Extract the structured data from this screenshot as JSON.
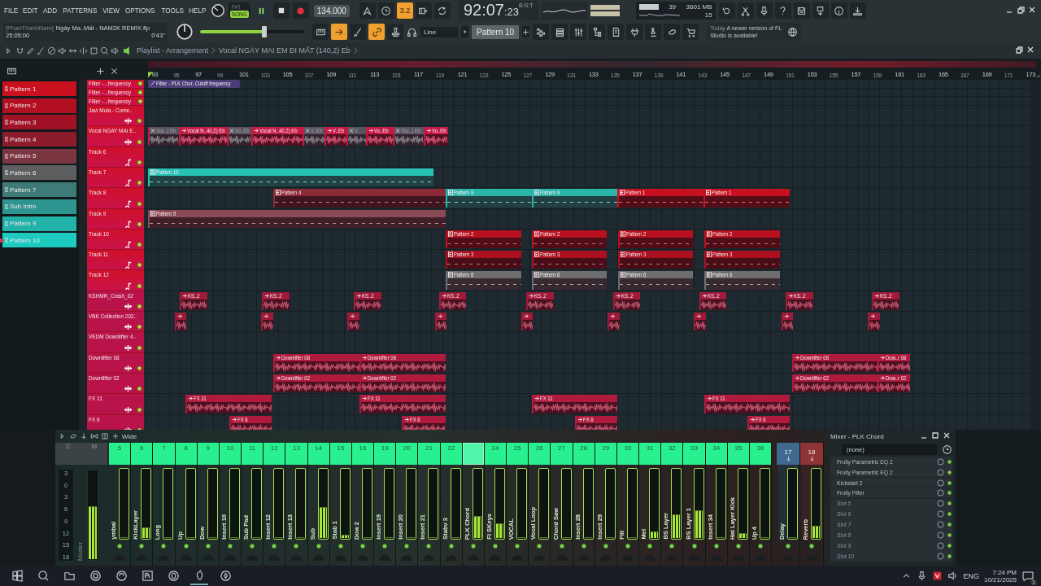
{
  "menu": [
    "FILE",
    "EDIT",
    "ADD",
    "PATTERNS",
    "VIEW",
    "OPTIONS",
    "TOOLS",
    "HELP"
  ],
  "transport": {
    "modes": [
      {
        "label": "PAT",
        "selected": false
      },
      {
        "label": "SONG",
        "selected": true
      }
    ],
    "tempo": "134.000"
  },
  "snap_buttons": [
    {
      "on": false
    },
    {
      "on": false
    },
    {
      "label": "3.2",
      "on": true
    },
    {
      "on": false
    },
    {
      "on": false
    }
  ],
  "time": {
    "main": "92:07",
    "ticks": ":23",
    "unit": "B:S:T"
  },
  "monitor": {
    "polyphony": "39",
    "memory": "3601 MB",
    "cpu": "15"
  },
  "project": {
    "user": "[PhanThanhNam]",
    "file": "Ngày Ma..Mất - NAM2K REMIX.flp",
    "length": "25:05:00",
    "time": "0'43''"
  },
  "master_volume": {
    "level": 0.62
  },
  "tool_buttons": [
    {
      "on": false
    },
    {
      "on": true
    },
    {
      "on": false
    },
    {
      "on": true
    },
    {
      "on": false
    }
  ],
  "draw_mode": "Line",
  "pattern_selector": "Pattern 10",
  "news": {
    "date": "Today",
    "text": "A newer version of FL Studio is available!"
  },
  "playlist": {
    "title": "Playlist - Arrangement",
    "clip": "Vocal NGÀY MAI EM ĐI MẤT (140,2) Eb",
    "ruler": [
      "93",
      "95",
      "97",
      "99",
      "101",
      "103",
      "105",
      "107",
      "109",
      "111",
      "113",
      "115",
      "117",
      "119",
      "121",
      "123",
      "125",
      "127",
      "129",
      "131",
      "133",
      "135",
      "137",
      "139",
      "141",
      "143",
      "145",
      "147",
      "149",
      "151",
      "153",
      "155",
      "157",
      "159",
      "161",
      "163",
      "165",
      "167",
      "169",
      "171",
      "173"
    ],
    "patterns": [
      {
        "label": "Pattern 1",
        "color": "#c8101e",
        "selected": false
      },
      {
        "label": "Pattern 2",
        "color": "#b20f20",
        "selected": false
      },
      {
        "label": "Pattern 3",
        "color": "#a21226",
        "selected": false
      },
      {
        "label": "Pattern 4",
        "color": "#8c1b2c",
        "selected": false
      },
      {
        "label": "Pattern 5",
        "color": "#7a3640",
        "selected": false
      },
      {
        "label": "Pattern 6",
        "color": "#5c5e60",
        "selected": false
      },
      {
        "label": "Pattern 7",
        "color": "#3e7a78",
        "selected": false
      },
      {
        "label": "Sub Intro",
        "color": "#2d9590",
        "selected": false
      },
      {
        "label": "Pattern 9",
        "color": "#22b2aa",
        "selected": false
      },
      {
        "label": "Pattern 10",
        "color": "#1ccabf",
        "selected": true
      }
    ],
    "tracks": [
      {
        "name": "Filter - ..frequency",
        "kind": "automation",
        "clips": [
          {
            "kind": "automation",
            "label": "Filter - PLK Chor..Cutoff frequency",
            "color": "#4c3d78",
            "muted": false
          }
        ]
      },
      {
        "name": "Filter - ..frequency",
        "kind": "automation"
      },
      {
        "name": "Filter - ..frequency",
        "kind": "automation"
      },
      {
        "name": "Javi Mula - Come..",
        "kind": "audio"
      },
      {
        "name": "Vocal NGAY MAI E..",
        "kind": "audio",
        "clips": [
          {
            "kind": "audio",
            "label": "Voc..) Eb",
            "color": "#c41a44",
            "muted": true
          },
          {
            "kind": "audio",
            "label": "Vocal N..40,2) Eb",
            "color": "#c41a44",
            "muted": false
          },
          {
            "kind": "audio",
            "label": "Vo..Eb",
            "color": "#c41a44",
            "muted": true
          },
          {
            "kind": "audio",
            "label": "Vocal N..40,2) Eb",
            "color": "#c41a44",
            "muted": false
          },
          {
            "kind": "audio",
            "label": "V..Eb",
            "color": "#c41a44",
            "muted": true
          },
          {
            "kind": "audio",
            "label": "V..Eb",
            "color": "#c41a44",
            "muted": false
          },
          {
            "kind": "audio",
            "label": "V..",
            "color": "#c41a44",
            "muted": true
          },
          {
            "kind": "audio",
            "label": "Vo..Eb",
            "color": "#c41a44",
            "muted": false
          },
          {
            "kind": "audio",
            "label": "Voc..) Eb",
            "color": "#c41a44",
            "muted": true
          },
          {
            "kind": "audio",
            "label": "Vo..Eb",
            "color": "#c41a44",
            "muted": false
          }
        ]
      },
      {
        "name": "Track 6",
        "kind": "pattern"
      },
      {
        "name": "Track 7",
        "kind": "pattern",
        "clips": [
          {
            "kind": "pattern",
            "label": "Pattern 10",
            "color": "#27c2b4",
            "muted": false
          }
        ]
      },
      {
        "name": "Track 8",
        "kind": "pattern",
        "clips": [
          {
            "kind": "pattern",
            "label": "Pattern 4",
            "color": "#8c2a38",
            "muted": false
          },
          {
            "kind": "pattern",
            "label": "Pattern 9",
            "color": "#2ab5aa",
            "muted": false
          },
          {
            "kind": "pattern",
            "label": "Pattern 9",
            "color": "#2ab5aa",
            "muted": false
          },
          {
            "kind": "pattern",
            "label": "Pattern 1",
            "color": "#c81020",
            "muted": false
          },
          {
            "kind": "pattern",
            "label": "Pattern 1",
            "color": "#c81020",
            "muted": false
          }
        ]
      },
      {
        "name": "Track 9",
        "kind": "pattern",
        "clips": [
          {
            "kind": "pattern",
            "label": "Pattern 5",
            "color": "#8a4a55",
            "muted": false
          }
        ]
      },
      {
        "name": "Track 10",
        "kind": "pattern",
        "clips": [
          {
            "kind": "pattern",
            "label": "Pattern 2",
            "color": "#b8101e",
            "muted": false
          },
          {
            "kind": "pattern",
            "label": "Pattern 2",
            "color": "#b8101e",
            "muted": false
          },
          {
            "kind": "pattern",
            "label": "Pattern 2",
            "color": "#b8101e",
            "muted": false
          },
          {
            "kind": "pattern",
            "label": "Pattern 2",
            "color": "#b8101e",
            "muted": false
          }
        ]
      },
      {
        "name": "Track 11",
        "kind": "pattern",
        "clips": [
          {
            "kind": "pattern",
            "label": "Pattern 3",
            "color": "#aa1020",
            "muted": false
          },
          {
            "kind": "pattern",
            "label": "Pattern 3",
            "color": "#aa1020",
            "muted": false
          },
          {
            "kind": "pattern",
            "label": "Pattern 3",
            "color": "#aa1020",
            "muted": false
          },
          {
            "kind": "pattern",
            "label": "Pattern 3",
            "color": "#aa1020",
            "muted": false
          }
        ]
      },
      {
        "name": "Track 12",
        "kind": "pattern",
        "clips": [
          {
            "kind": "pattern",
            "label": "Pattern 6",
            "color": "#6e6e70",
            "muted": false
          },
          {
            "kind": "pattern",
            "label": "Pattern 6",
            "color": "#6e6e70",
            "muted": false
          },
          {
            "kind": "pattern",
            "label": "Pattern 6",
            "color": "#6e6e70",
            "muted": false
          },
          {
            "kind": "pattern",
            "label": "Pattern 6",
            "color": "#6e6e70",
            "muted": false
          }
        ]
      },
      {
        "name": "KSHMR_Crash_02",
        "kind": "audio",
        "clips": [
          {
            "kind": "audio",
            "label": "KS..2",
            "color": "#a01a3a",
            "muted": false
          },
          {
            "kind": "audio",
            "label": "KS..2",
            "color": "#a01a3a",
            "muted": false
          },
          {
            "kind": "audio",
            "label": "KS..2",
            "color": "#a01a3a",
            "muted": false
          },
          {
            "kind": "audio",
            "label": "KS..2",
            "color": "#a01a3a",
            "muted": false
          },
          {
            "kind": "audio",
            "label": "KS..2",
            "color": "#a01a3a",
            "muted": false
          },
          {
            "kind": "audio",
            "label": "KS..2",
            "color": "#a01a3a",
            "muted": false
          },
          {
            "kind": "audio",
            "label": "KS..2",
            "color": "#a01a3a",
            "muted": false
          },
          {
            "kind": "audio",
            "label": "KS..2",
            "color": "#a01a3a",
            "muted": false
          },
          {
            "kind": "audio",
            "label": "KS..2",
            "color": "#a01a3a",
            "muted": false
          }
        ]
      },
      {
        "name": "VBK Collection 202..",
        "kind": "audio",
        "clips": [
          {
            "kind": "audio",
            "color": "#a01a3a",
            "muted": false
          },
          {
            "kind": "audio",
            "color": "#a01a3a",
            "muted": false
          },
          {
            "kind": "audio",
            "color": "#a01a3a",
            "muted": false
          },
          {
            "kind": "audio",
            "color": "#a01a3a",
            "muted": false
          },
          {
            "kind": "audio",
            "color": "#a01a3a",
            "muted": false
          },
          {
            "kind": "audio",
            "color": "#a01a3a",
            "muted": false
          },
          {
            "kind": "audio",
            "color": "#a01a3a",
            "muted": false
          },
          {
            "kind": "audio",
            "color": "#a01a3a",
            "muted": false
          },
          {
            "kind": "audio",
            "color": "#a01a3a",
            "muted": false
          }
        ]
      },
      {
        "name": "VEDM Downlifter 4..",
        "kind": "audio"
      },
      {
        "name": "Downlifter 08",
        "kind": "audio",
        "clips": [
          {
            "kind": "audio",
            "label": "Downlifter 08",
            "color": "#b01a3c",
            "muted": false
          },
          {
            "kind": "audio",
            "label": "Downlifter 08",
            "color": "#b01a3c",
            "muted": false
          },
          {
            "kind": "audio",
            "label": "Downlifter 08",
            "color": "#b01a3c",
            "muted": false
          },
          {
            "kind": "audio",
            "label": "Dow..r 08",
            "color": "#b01a3c",
            "muted": false
          }
        ]
      },
      {
        "name": "Downlifter 02",
        "kind": "audio",
        "clips": [
          {
            "kind": "audio",
            "label": "Downlifter 02",
            "color": "#b01a3c",
            "muted": false
          },
          {
            "kind": "audio",
            "label": "Downlifter 02",
            "color": "#b01a3c",
            "muted": false
          },
          {
            "kind": "audio",
            "label": "Downlifter 02",
            "color": "#b01a3c",
            "muted": false
          },
          {
            "kind": "audio",
            "label": "Dow..r 02",
            "color": "#b01a3c",
            "muted": false
          }
        ]
      },
      {
        "name": "FX 11",
        "kind": "audio",
        "clips": [
          {
            "kind": "audio",
            "label": "FX 11",
            "color": "#b01a3c",
            "muted": false
          },
          {
            "kind": "audio",
            "label": "FX 11",
            "color": "#b01a3c",
            "muted": false
          },
          {
            "kind": "audio",
            "label": "FX 11",
            "color": "#b01a3c",
            "muted": false
          },
          {
            "kind": "audio",
            "label": "FX 11",
            "color": "#b01a3c",
            "muted": false
          }
        ]
      },
      {
        "name": "FX 6",
        "kind": "audio",
        "clips": [
          {
            "kind": "audio",
            "label": "FX 6",
            "color": "#b01a3c",
            "muted": false
          },
          {
            "kind": "audio",
            "label": "FX 6",
            "color": "#b01a3c",
            "muted": false
          },
          {
            "kind": "audio",
            "label": "FX 6",
            "color": "#b01a3c",
            "muted": false
          },
          {
            "kind": "audio",
            "label": "FX 6",
            "color": "#b01a3c",
            "muted": false
          }
        ]
      }
    ]
  },
  "mixer": {
    "toolbar_label": "Wide",
    "master": {
      "labels": [
        "C",
        "M"
      ],
      "scale": [
        "3",
        "0",
        "3",
        "6",
        "9",
        "12",
        "15",
        "18"
      ],
      "name": "Master",
      "level": 0.6
    },
    "strips": [
      {
        "number": "5",
        "name": "ymbal",
        "level": 0,
        "selected": false
      },
      {
        "number": "6",
        "name": "KickLayer",
        "level": 0.15,
        "selected": false
      },
      {
        "number": "7",
        "name": "Long",
        "level": 0,
        "selected": false
      },
      {
        "number": "8",
        "name": "Up",
        "level": 0,
        "selected": false
      },
      {
        "number": "9",
        "name": "Dow",
        "level": 0,
        "selected": false
      },
      {
        "number": "10",
        "name": "Insert 10",
        "level": 0,
        "selected": false
      },
      {
        "number": "11",
        "name": "Sub Pad",
        "level": 0,
        "selected": false
      },
      {
        "number": "12",
        "name": "Insert 12",
        "level": 0,
        "selected": false
      },
      {
        "number": "13",
        "name": "Insert 13",
        "level": 0,
        "selected": false
      },
      {
        "number": "14",
        "name": "Sub",
        "level": 0.45,
        "selected": false
      },
      {
        "number": "15",
        "name": "Stab 1",
        "level": 0.05,
        "selected": false
      },
      {
        "number": "16",
        "name": "Dow 2",
        "level": 0,
        "selected": false
      },
      {
        "number": "19",
        "name": "Insert 19",
        "level": 0,
        "selected": false
      },
      {
        "number": "20",
        "name": "Insert 20",
        "level": 0,
        "selected": false
      },
      {
        "number": "21",
        "name": "Insert 21",
        "level": 0,
        "selected": false
      },
      {
        "number": "22",
        "name": "Stabv 3",
        "level": 0,
        "selected": false
      },
      {
        "name": "PLK Chord",
        "level": 0.32,
        "selected": true
      },
      {
        "number": "24",
        "name": "Fl SKeys",
        "level": 0.22,
        "selected": false
      },
      {
        "number": "25",
        "name": "VOCAL",
        "level": 0,
        "selected": false
      },
      {
        "number": "26",
        "name": "Vocal Loop",
        "level": 0,
        "selected": false
      },
      {
        "number": "27",
        "name": "Chord Saw",
        "level": 0,
        "selected": false
      },
      {
        "number": "28",
        "name": "Insert 28",
        "level": 0,
        "selected": false
      },
      {
        "number": "29",
        "name": "Insert 29",
        "level": 0,
        "selected": false
      },
      {
        "number": "30",
        "name": "Fill",
        "level": 0,
        "selected": false
      },
      {
        "number": "31",
        "name": "Mel",
        "level": 0.09,
        "selected": false
      },
      {
        "number": "32",
        "name": "BS Layer",
        "level": 0.35,
        "selected": false
      },
      {
        "number": "33",
        "name": "BS Layer 1",
        "level": 0.4,
        "selected": false
      },
      {
        "number": "34",
        "name": "Insert 34",
        "level": 0,
        "selected": false
      },
      {
        "number": "35",
        "name": "Hat Layer Kick",
        "level": 0.07,
        "selected": false
      },
      {
        "number": "36",
        "name": "Up 4",
        "level": 0,
        "selected": false
      }
    ],
    "sends": [
      {
        "number": "17",
        "name": "Delay",
        "level": 0,
        "color": "#3d6a8e"
      },
      {
        "number": "18",
        "name": "Reverb",
        "level": 0.18,
        "color": "#8e3434"
      }
    ],
    "panel": {
      "title": "Mixer - PLK Chord",
      "preset": "(none)",
      "slots": [
        {
          "name": "Fruity Parametric EQ 2",
          "kind": "plugin"
        },
        {
          "name": "Fruity Parametric EQ 2",
          "kind": "plugin"
        },
        {
          "name": "Kickstart 2",
          "kind": "plugin"
        },
        {
          "name": "Fruity Filter",
          "kind": "plugin"
        },
        {
          "name": "Slot 5",
          "kind": "empty"
        },
        {
          "name": "Slot 6",
          "kind": "empty"
        },
        {
          "name": "Slot 7",
          "kind": "empty"
        },
        {
          "name": "Slot 8",
          "kind": "empty"
        },
        {
          "name": "Slot 9",
          "kind": "empty"
        },
        {
          "name": "Slot 10",
          "kind": "empty"
        }
      ]
    }
  },
  "taskbar": {
    "language": "ENG",
    "time": "7:24 PM",
    "date": "10/21/2025",
    "notifications": "1"
  }
}
